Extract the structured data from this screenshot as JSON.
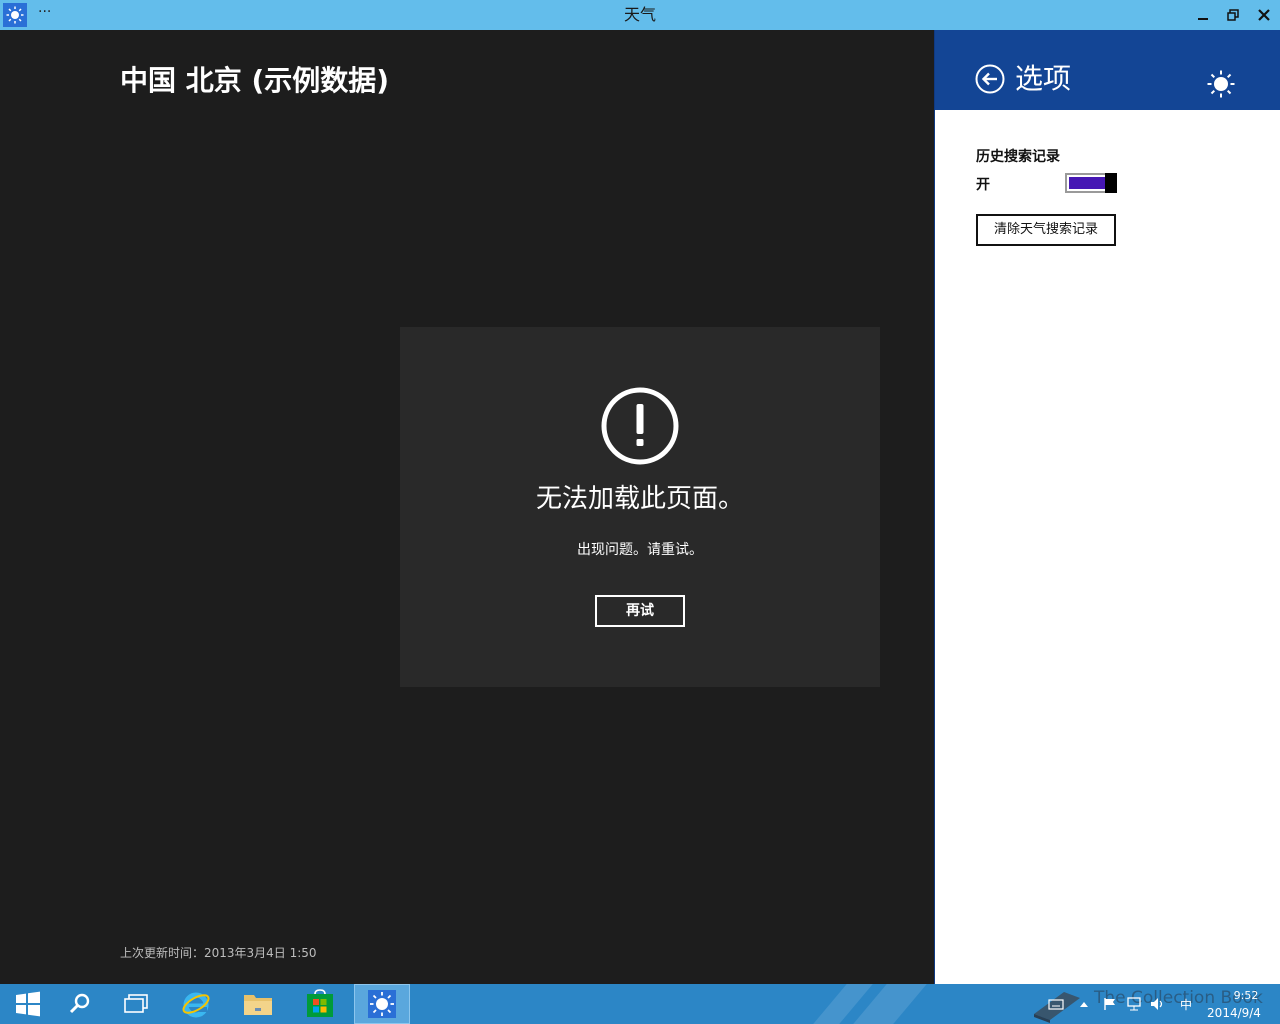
{
  "window": {
    "title": "天气",
    "menu_dots": "···",
    "icon": "weather-sun-icon",
    "controls": [
      "minimize-icon",
      "restore-icon",
      "close-icon"
    ]
  },
  "main": {
    "location": "中国 北京 (示例数据)",
    "error": {
      "icon": "exclamation-circle-icon",
      "title": "无法加载此页面。",
      "message": "出现问题。请重试。",
      "retry_label": "再试"
    },
    "last_update": "上次更新时间：2013年3月4日 1:50"
  },
  "settings_pane": {
    "title": "选项",
    "back_icon": "back-arrow-icon",
    "header_icon": "sun-icon",
    "history_label": "历史搜索记录",
    "toggle_state": "开",
    "toggle_on": true,
    "clear_button": "清除天气搜索记录"
  },
  "taskbar": {
    "items": [
      "start-button",
      "search",
      "task-view",
      "internet-explorer",
      "file-explorer",
      "store",
      "weather"
    ],
    "active_item": "weather",
    "tray": {
      "ime": "中",
      "time": "9:52",
      "date": "2014/9/4"
    },
    "watermark": "The Collection Book"
  },
  "colors": {
    "titlebar": "#63bdeb",
    "background": "#1d1d1d",
    "error_panel": "#292929",
    "pane_header": "#134595",
    "toggle_fill": "#4617b4",
    "taskbar": "#2c86c6"
  }
}
